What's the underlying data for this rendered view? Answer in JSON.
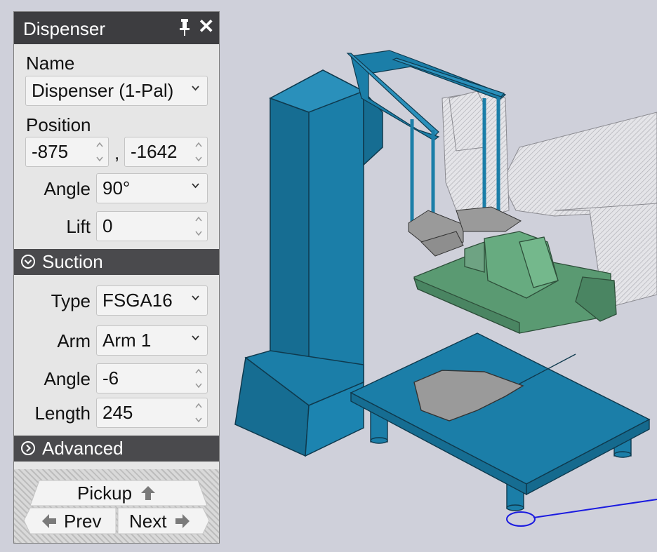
{
  "panel": {
    "title": "Dispenser",
    "name_label": "Name",
    "name_value": "Dispenser (1-Pal)",
    "position_label": "Position",
    "position_x": "-875",
    "position_separator": ",",
    "position_y": "-1642",
    "angle_label": "Angle",
    "angle_value": "90°",
    "lift_label": "Lift",
    "lift_value": "0"
  },
  "suction": {
    "title": "Suction",
    "type_label": "Type",
    "type_value": "FSGA16",
    "arm_label": "Arm",
    "arm_value": "Arm 1",
    "angle_label": "Angle",
    "angle_value": "-6",
    "length_label": "Length",
    "length_value": "245"
  },
  "advanced": {
    "title": "Advanced"
  },
  "nav": {
    "pickup_label": "Pickup",
    "prev_label": "Prev",
    "next_label": "Next"
  },
  "icons": [
    "pin-icon",
    "close-icon",
    "chevron-down-icon",
    "spinner-icon",
    "collapse-circle-icon",
    "expand-circle-icon",
    "arrow-up-icon",
    "arrow-left-icon",
    "arrow-right-icon"
  ],
  "colors": {
    "viewport_bg": "#cfd0da",
    "machine_blue": "#1b7ea8",
    "pallet_green": "#5a9a72",
    "panel_header": "#3d3d40",
    "section_header": "#4a4a4d"
  }
}
